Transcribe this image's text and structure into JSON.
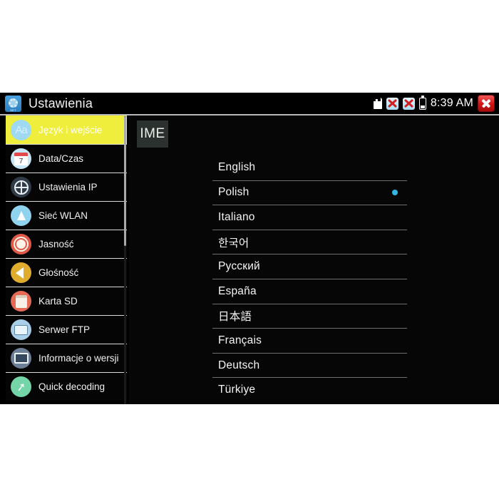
{
  "window": {
    "title": "Ustawienia",
    "app_icon": "settings-gear-icon",
    "app_icon_label": "SET"
  },
  "status_bar": {
    "sd_card_icon": "sd-card-icon",
    "network_disabled_icon_1": "network-disabled-icon",
    "network_disabled_icon_2": "network-disabled-icon",
    "battery_icon": "battery-icon",
    "clock": "8:39 AM",
    "close_icon": "close-icon"
  },
  "sidebar": {
    "items": [
      {
        "label": "Język i wejście",
        "icon": "language-input-icon",
        "active": true
      },
      {
        "label": "Data/Czas",
        "icon": "calendar-icon",
        "active": false
      },
      {
        "label": "Ustawienia IP",
        "icon": "globe-icon",
        "active": false
      },
      {
        "label": "Sieć WLAN",
        "icon": "wifi-antenna-icon",
        "active": false
      },
      {
        "label": "Jasność",
        "icon": "brightness-sun-icon",
        "active": false
      },
      {
        "label": "Głośność",
        "icon": "volume-speaker-icon",
        "active": false
      },
      {
        "label": "Karta SD",
        "icon": "sd-card-icon",
        "active": false
      },
      {
        "label": "Serwer FTP",
        "icon": "ftp-server-icon",
        "active": false
      },
      {
        "label": "Informacje o wersji",
        "icon": "monitor-info-icon",
        "active": false
      },
      {
        "label": "Quick decoding",
        "icon": "rocket-icon",
        "active": false
      }
    ],
    "active_background": "#f0ee3c"
  },
  "main": {
    "ime_button_label": "IME",
    "languages": [
      {
        "label": "English",
        "selected": false
      },
      {
        "label": "Polish",
        "selected": true
      },
      {
        "label": "Italiano",
        "selected": false
      },
      {
        "label": "한국어",
        "selected": false
      },
      {
        "label": "Русский",
        "selected": false
      },
      {
        "label": "España",
        "selected": false
      },
      {
        "label": "日本語",
        "selected": false
      },
      {
        "label": "Français",
        "selected": false
      },
      {
        "label": "Deutsch",
        "selected": false
      },
      {
        "label": "Türkiye",
        "selected": false
      }
    ],
    "selected_dot_color": "#33b5e5"
  }
}
